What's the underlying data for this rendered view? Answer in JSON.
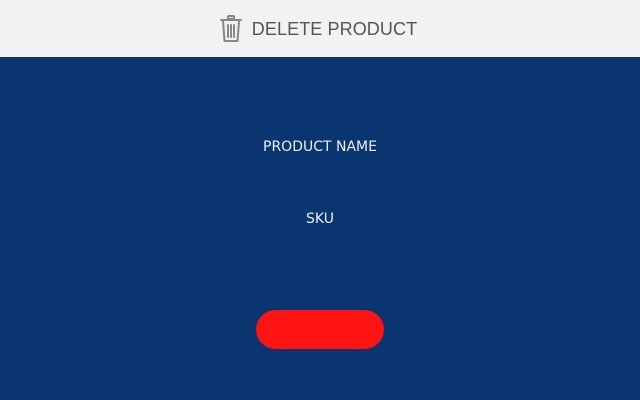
{
  "header": {
    "title": "DELETE PRODUCT",
    "icon": "trash-icon",
    "background_color": "#f2f2f2",
    "text_color": "#555555"
  },
  "form": {
    "product_name_label": "PRODUCT NAME",
    "sku_label": "SKU",
    "background_color": "#0b3570"
  },
  "actions": {
    "delete_button_label": "",
    "delete_button_color": "#ff1414"
  }
}
